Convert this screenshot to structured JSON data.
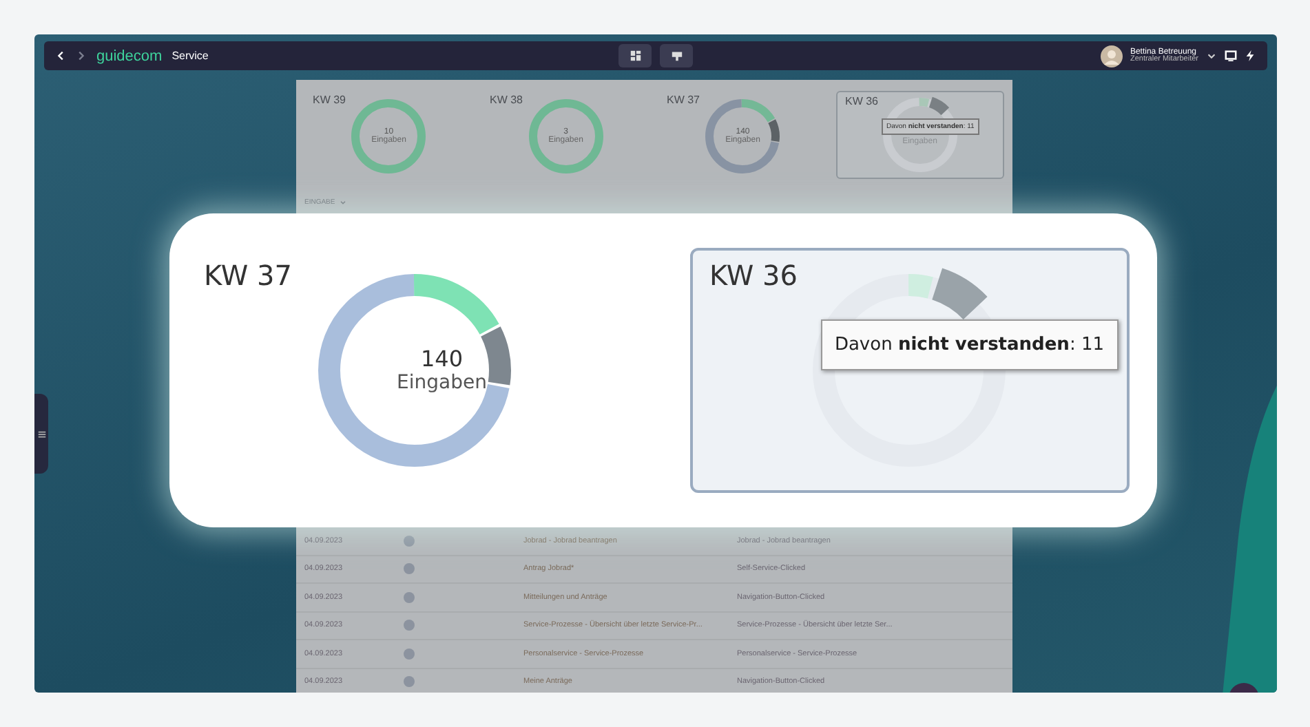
{
  "topbar": {
    "brand": "guidecom",
    "section": "Service",
    "user_name": "Bettina Betreuung",
    "user_role": "Zentraler Mitarbeiter"
  },
  "weeks": [
    {
      "label": "KW 39",
      "count": "10",
      "unit": "Eingaben",
      "kind": "understood"
    },
    {
      "label": "KW 38",
      "count": "3",
      "unit": "Eingaben",
      "kind": "understood"
    },
    {
      "label": "KW 37",
      "count": "140",
      "unit": "Eingaben",
      "kind": "mixed"
    },
    {
      "label": "KW 36",
      "tooltip": "Davon **nicht verstanden**: 11",
      "unit": "Eingaben",
      "kind": "hovered"
    }
  ],
  "filter_label": "EINGABE",
  "rows": [
    {
      "date": "04.09.2023",
      "input": "Jobrad - Jobrad beantragen",
      "result": "Jobrad - Jobrad beantragen"
    },
    {
      "date": "04.09.2023",
      "input": "Antrag Jobrad*",
      "result": "Self-Service-Clicked"
    },
    {
      "date": "04.09.2023",
      "input": "Mitteilungen und Anträge",
      "result": "Navigation-Button-Clicked"
    },
    {
      "date": "04.09.2023",
      "input": "Service-Prozesse - Übersicht über letzte Service-Pr...",
      "result": "Service-Prozesse - Übersicht über letzte Ser..."
    },
    {
      "date": "04.09.2023",
      "input": "Personalservice - Service-Prozesse",
      "result": "Personalservice - Service-Prozesse"
    },
    {
      "date": "04.09.2023",
      "input": "Meine Anträge",
      "result": "Navigation-Button-Clicked"
    }
  ],
  "zoom": [
    {
      "label": "KW 37",
      "count": "140",
      "unit": "Eingaben",
      "kind": "mixed"
    },
    {
      "label": "KW 36",
      "tooltip": "Davon **nicht verstanden**: 11",
      "kind": "hovered"
    }
  ]
}
